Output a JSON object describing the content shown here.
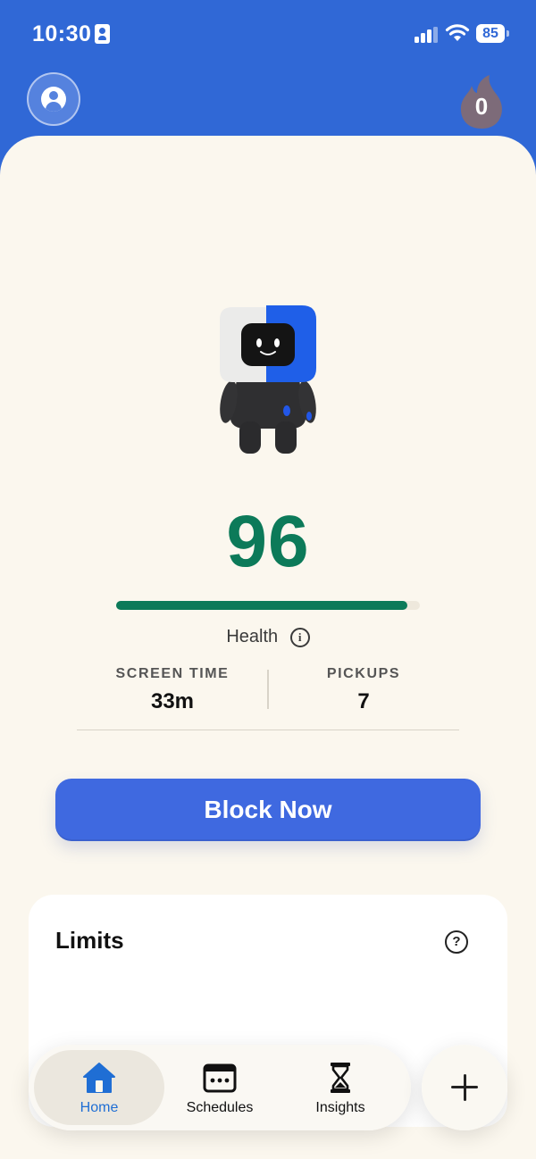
{
  "status_bar": {
    "time": "10:30",
    "battery": "85",
    "icons": [
      "id-card-icon",
      "signal-icon",
      "wifi-icon",
      "battery-icon"
    ]
  },
  "header": {
    "profile_icon": "person-icon",
    "streak_icon": "flame-icon",
    "streak_count": "0"
  },
  "health": {
    "score": "96",
    "score_value": 96,
    "score_max": 100,
    "label": "Health",
    "info_glyph": "i"
  },
  "stats": [
    {
      "label": "SCREEN TIME",
      "value": "33m"
    },
    {
      "label": "PICKUPS",
      "value": "7"
    }
  ],
  "block_button": {
    "label": "Block Now"
  },
  "limits": {
    "title": "Limits",
    "help_glyph": "?"
  },
  "tabs": [
    {
      "label": "Home",
      "icon": "house-icon",
      "active": true
    },
    {
      "label": "Schedules",
      "icon": "calendar-icon",
      "active": false
    },
    {
      "label": "Insights",
      "icon": "hourglass-icon",
      "active": false
    }
  ],
  "add_button": {
    "icon": "plus-icon"
  },
  "colors": {
    "header_blue": "#3068d6",
    "background": "#fbf7ee",
    "health_green": "#0c7a59",
    "button_blue": "#3f69e0",
    "active_tab": "#1f6ed4"
  }
}
